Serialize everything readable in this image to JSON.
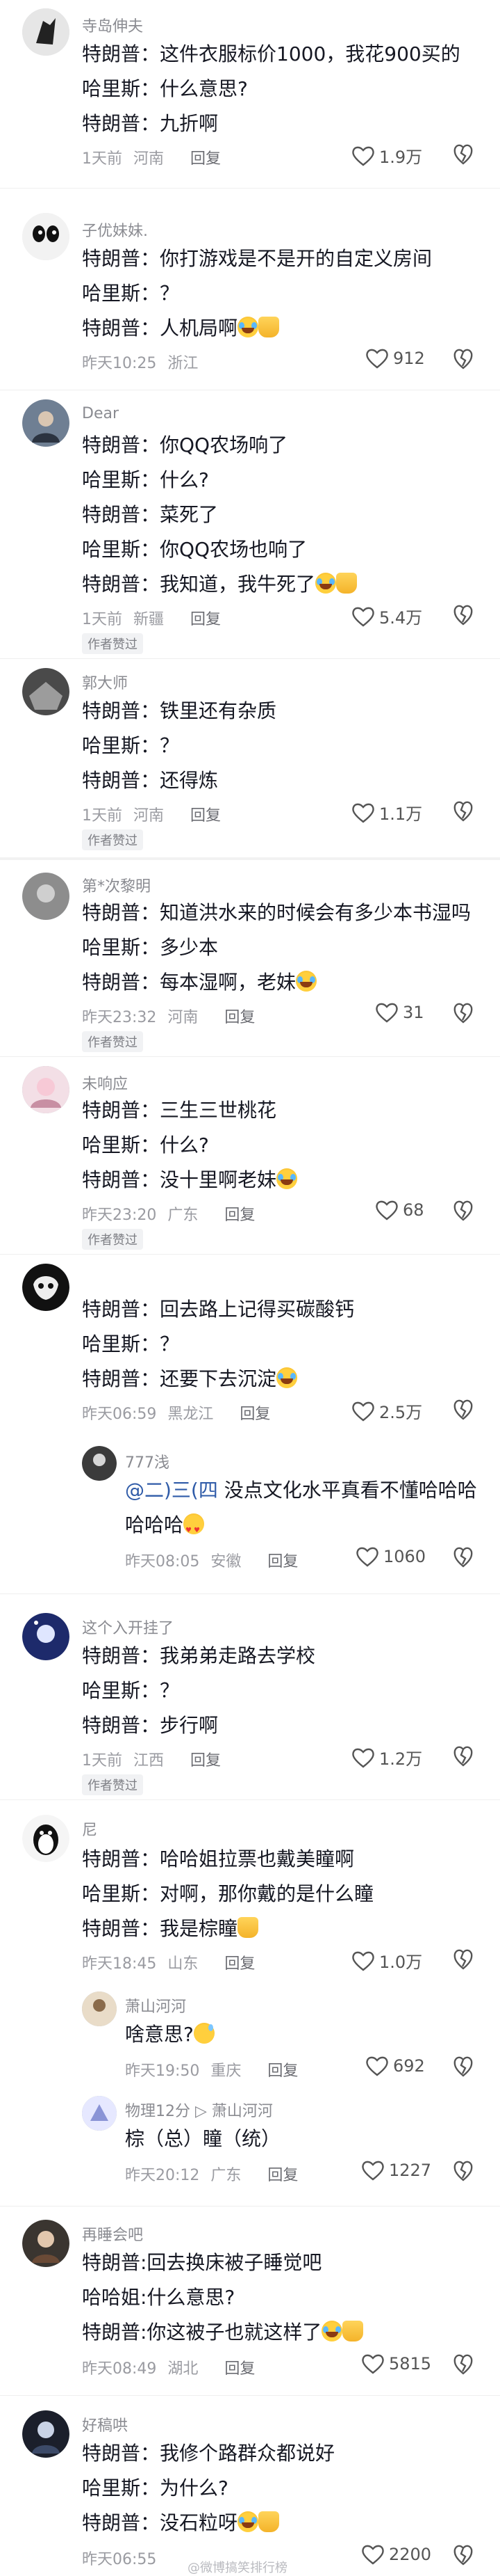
{
  "comments": [
    {
      "user": "寺岛伸夫",
      "lines": [
        "特朗普：这件衣服标价1000，我花900买的",
        "哈里斯：什么意思?",
        "特朗普：九折啊"
      ],
      "time": "1天前",
      "location": "河南",
      "reply": "回复",
      "likes": "1.9万"
    },
    {
      "user": "子优妹妹.",
      "lines": [
        "特朗普：你打游戏是不是开的自定义房间",
        "哈里斯：？",
        "特朗普：人机局啊"
      ],
      "time": "昨天10:25",
      "location": "浙江",
      "likes": "912"
    },
    {
      "user": "Dear",
      "lines": [
        "特朗普：你QQ农场响了",
        "哈里斯：什么?",
        "特朗普：菜死了",
        "哈里斯：你QQ农场也响了",
        "特朗普：我知道，我牛死了"
      ],
      "time": "1天前",
      "location": "新疆",
      "reply": "回复",
      "likes": "5.4万",
      "badge": "作者赞过"
    },
    {
      "user": "郭大师",
      "lines": [
        "特朗普：铁里还有杂质",
        "哈里斯：？",
        "特朗普：还得炼"
      ],
      "time": "1天前",
      "location": "河南",
      "reply": "回复",
      "likes": "1.1万",
      "badge": "作者赞过"
    },
    {
      "user": "第*次黎明",
      "lines": [
        "特朗普：知道洪水来的时候会有多少本书湿吗",
        "哈里斯：多少本",
        "特朗普：每本湿啊，老妹"
      ],
      "time": "昨天23:32",
      "location": "河南",
      "reply": "回复",
      "likes": "31",
      "badge": "作者赞过"
    },
    {
      "user": "未响应",
      "lines": [
        "特朗普：三生三世桃花",
        "哈里斯：什么?",
        "特朗普：没十里啊老妹"
      ],
      "time": "昨天23:20",
      "location": "广东",
      "reply": "回复",
      "likes": "68",
      "badge": "作者赞过"
    },
    {
      "user": "",
      "lines": [
        "特朗普：回去路上记得买碳酸钙",
        "哈里斯：？",
        "特朗普：还要下去沉淀"
      ],
      "time": "昨天06:59",
      "location": "黑龙江",
      "reply": "回复",
      "likes": "2.5万",
      "sub": {
        "user": "777浅",
        "mention": "@二)三(四",
        "text1": " 没点文化水平真看不懂哈哈哈",
        "text2": "哈哈哈",
        "time": "昨天08:05",
        "location": "安徽",
        "reply": "回复",
        "likes": "1060"
      }
    },
    {
      "user": "这个入开挂了",
      "lines": [
        "特朗普：我弟弟走路去学校",
        "哈里斯：？",
        "特朗普：步行啊"
      ],
      "time": "1天前",
      "location": "江西",
      "reply": "回复",
      "likes": "1.2万",
      "badge": "作者赞过"
    },
    {
      "user": "尼",
      "lines": [
        "特朗普：哈哈姐拉票也戴美瞳啊",
        "哈里斯：对啊，那你戴的是什么瞳",
        "特朗普：我是棕瞳"
      ],
      "time": "昨天18:45",
      "location": "山东",
      "reply": "回复",
      "likes": "1.0万",
      "subs": [
        {
          "user": "萧山河河",
          "text": "啥意思?",
          "time": "昨天19:50",
          "location": "重庆",
          "reply": "回复",
          "likes": "692"
        },
        {
          "user": "物理12分 ▷ 萧山河河",
          "text": "棕（总）瞳（统）",
          "time": "昨天20:12",
          "location": "广东",
          "reply": "回复",
          "likes": "1227"
        }
      ]
    },
    {
      "user": "再睡会吧",
      "lines": [
        "特朗普:回去换床被子睡觉吧",
        "哈哈姐:什么意思?",
        "特朗普:你这被子也就这样了"
      ],
      "time": "昨天08:49",
      "location": "湖北",
      "reply": "回复",
      "likes": "5815"
    },
    {
      "user": "好稿哄",
      "lines": [
        "特朗普：我修个路群众都说好",
        "哈里斯：为什么?",
        "特朗普：没石粒呀"
      ],
      "time": "昨天06:55",
      "location": "",
      "reply": "",
      "likes": "2200"
    }
  ],
  "watermark": "@微博搞笑排行榜"
}
